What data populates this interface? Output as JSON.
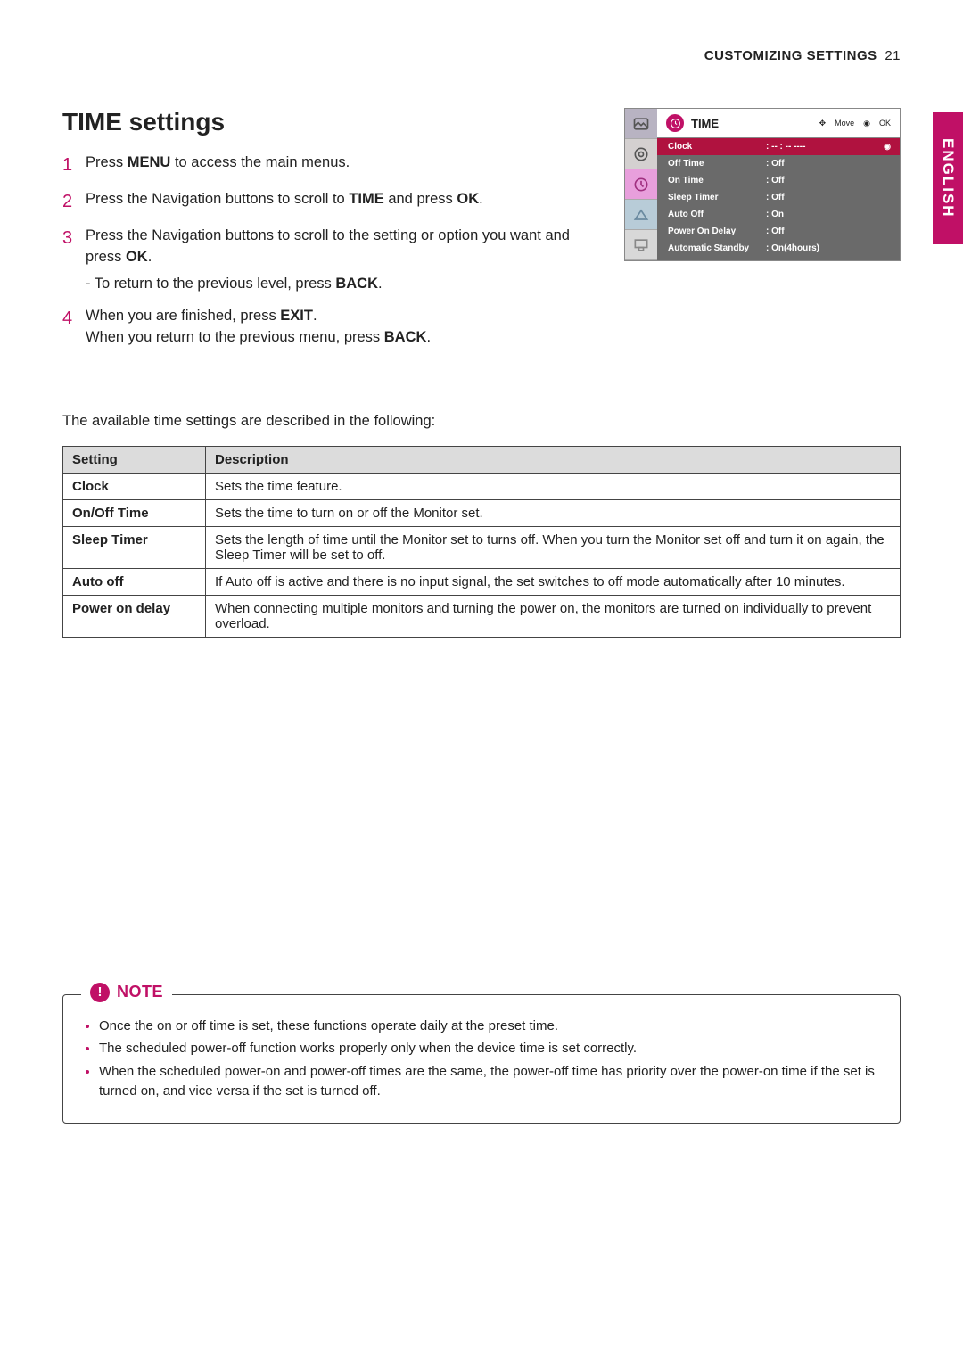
{
  "header": {
    "section": "CUSTOMIZING SETTINGS",
    "page_number": "21"
  },
  "language_tab": "ENGLISH",
  "title": "TIME settings",
  "steps": {
    "s1": {
      "num": "1",
      "pre": "Press ",
      "b1": "MENU",
      "post": " to access the main menus."
    },
    "s2": {
      "num": "2",
      "pre": "Press the Navigation buttons to scroll to ",
      "b1": "TIME",
      "mid": " and press ",
      "b2": "OK",
      "post": "."
    },
    "s3": {
      "num": "3",
      "pre": "Press the Navigation buttons to scroll to the setting or option you want and press ",
      "b1": "OK",
      "post": ".",
      "sub_pre": "- To return to the previous level, press ",
      "sub_b": "BACK",
      "sub_post": "."
    },
    "s4": {
      "num": "4",
      "l1_pre": "When you are finished, press ",
      "l1_b": "EXIT",
      "l1_post": ".",
      "l2_pre": "When you return to the previous menu, press ",
      "l2_b": "BACK",
      "l2_post": "."
    }
  },
  "osd": {
    "title": "TIME",
    "nav_move": "Move",
    "nav_ok": "OK",
    "rows": [
      {
        "label": "Clock",
        "value": "-- : -- ----",
        "active": true
      },
      {
        "label": "Off Time",
        "value": "Off"
      },
      {
        "label": "On Time",
        "value": "Off"
      },
      {
        "label": "Sleep Timer",
        "value": "Off"
      },
      {
        "label": "Auto Off",
        "value": "On"
      },
      {
        "label": "Power On Delay",
        "value": "Off"
      },
      {
        "label": "Automatic Standby",
        "value": "On(4hours)"
      }
    ]
  },
  "intro": "The available time settings are described in the following:",
  "table": {
    "head_setting": "Setting",
    "head_desc": "Description",
    "rows": [
      {
        "s": "Clock",
        "d": "Sets the time feature."
      },
      {
        "s": "On/Off Time",
        "d": "Sets the time to turn on or off the Monitor set."
      },
      {
        "s": "Sleep Timer",
        "d": "Sets the length of time until the Monitor set to turns off. When you turn the Monitor set off and turn it on again, the Sleep Timer will be set to off."
      },
      {
        "s": "Auto off",
        "d": "If Auto off is active and there is no input signal, the set switches to off mode automatically after 10 minutes."
      },
      {
        "s": "Power on delay",
        "d": "When connecting multiple monitors and turning the power on, the monitors are turned on individually to prevent overload."
      }
    ]
  },
  "note": {
    "title": "NOTE",
    "items": [
      "Once the on or off time is set, these functions operate daily at the preset time.",
      "The scheduled power-off function works properly only when the device time is set correctly.",
      "When the scheduled power-on and power-off times are the same, the power-off time has priority over the power-on time if the set is turned on, and vice versa if the set is turned off."
    ]
  }
}
